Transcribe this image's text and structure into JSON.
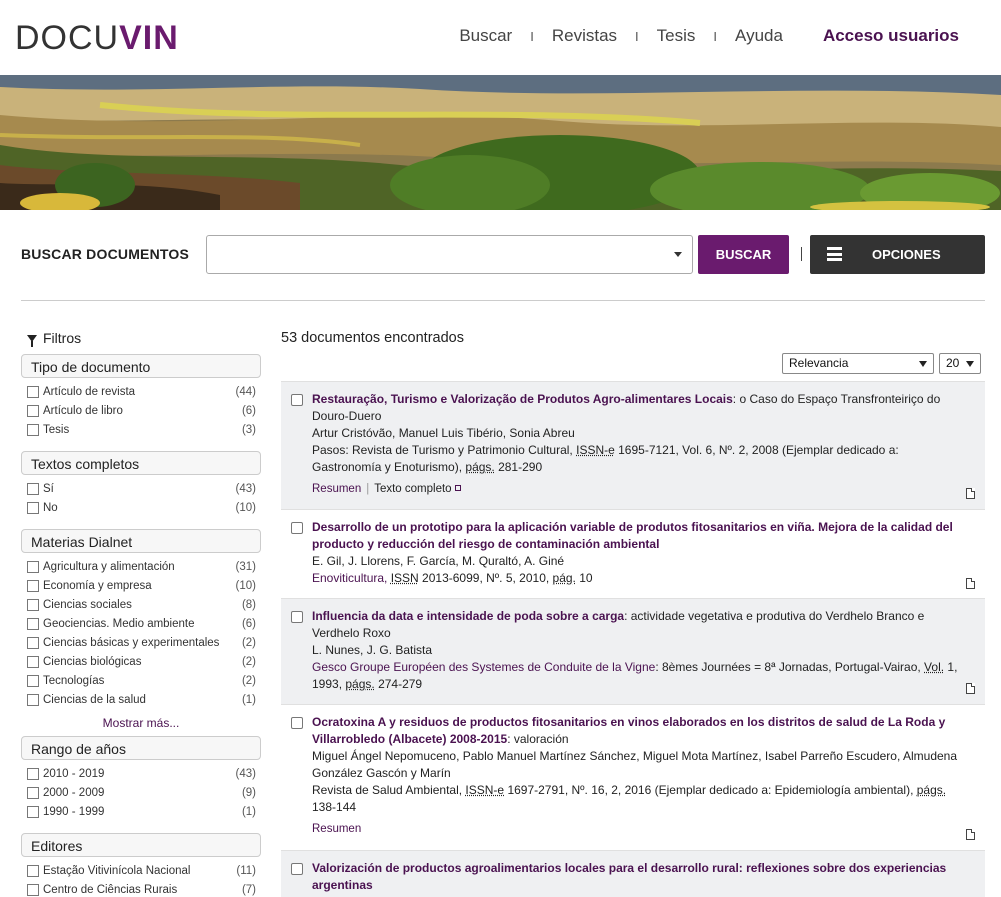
{
  "header": {
    "logo_a": "DOCU",
    "logo_b": "VIN",
    "nav": [
      "Buscar",
      "Revistas",
      "Tesis",
      "Ayuda"
    ],
    "nav_strong": "Acceso usuarios",
    "separator": "I"
  },
  "search": {
    "label": "BUSCAR DOCUMENTOS",
    "value": "",
    "button": "BUSCAR",
    "options_button": "OPCIONES"
  },
  "sidebar": {
    "title": "Filtros",
    "groups": [
      {
        "title": "Tipo de documento",
        "items": [
          {
            "name": "Artículo de revista",
            "count": "(44)"
          },
          {
            "name": "Artículo de libro",
            "count": "(6)"
          },
          {
            "name": "Tesis",
            "count": "(3)"
          }
        ]
      },
      {
        "title": "Textos completos",
        "items": [
          {
            "name": "Sí",
            "count": "(43)"
          },
          {
            "name": "No",
            "count": "(10)"
          }
        ]
      },
      {
        "title": "Materias Dialnet",
        "items": [
          {
            "name": "Agricultura y alimentación",
            "count": "(31)"
          },
          {
            "name": "Economía y empresa",
            "count": "(10)"
          },
          {
            "name": "Ciencias sociales",
            "count": "(8)"
          },
          {
            "name": "Geociencias. Medio ambiente",
            "count": "(6)"
          },
          {
            "name": "Ciencias básicas y experimentales",
            "count": "(2)"
          },
          {
            "name": "Ciencias biológicas",
            "count": "(2)"
          },
          {
            "name": "Tecnologías",
            "count": "(2)"
          },
          {
            "name": "Ciencias de la salud",
            "count": "(1)"
          }
        ]
      },
      {
        "title": "Rango de años",
        "items": [
          {
            "name": "2010 - 2019",
            "count": "(43)"
          },
          {
            "name": "2000 - 2009",
            "count": "(9)"
          },
          {
            "name": "1990 - 1999",
            "count": "(1)"
          }
        ]
      },
      {
        "title": "Editores",
        "items": [
          {
            "name": "Estação Vitivinícola Nacional",
            "count": "(11)"
          },
          {
            "name": "Centro de Ciências Rurais",
            "count": "(7)"
          }
        ]
      }
    ],
    "more": "Mostrar más..."
  },
  "results": {
    "found": "53 documentos encontrados",
    "sort": "Relevancia",
    "per_page": "20",
    "items": [
      {
        "title": "Restauração, Turismo e Valorização de Produtos Agro-alimentares Locais",
        "subtitle": ": o Caso do Espaço Transfronteiriço do Douro-Duero",
        "authors": "Artur Cristóvão, Manuel Luis Tibério, Sonia Abreu",
        "source_a": "Pasos: Revista de Turismo y Patrimonio Cultural, ",
        "source_u1": "ISSN-e",
        "source_b": " 1695-7121, Vol. 6, Nº. 2, 2008 (Ejemplar dedicado a: Gastronomía y Enoturismo), ",
        "source_u2": "págs.",
        "source_c": " 281-290",
        "link1": "Resumen",
        "link2": "Texto completo"
      },
      {
        "title": "Desarrollo de un prototipo para la aplicación variable de produtos fitosanitarios en viña. Mejora de la calidad del producto y reducción del riesgo de contaminación ambiental",
        "subtitle": "",
        "authors": "E. Gil, J. Llorens, F. García, M. Quraltó, A. Giné",
        "source_a": "Enoviticultura, ",
        "source_u1": "ISSN",
        "source_b": " 2013-6099, Nº. 5, 2010, ",
        "source_u2": "pág.",
        "source_c": " 10"
      },
      {
        "title": "Influencia da data e intensidade de poda sobre a carga",
        "subtitle": ": actividade vegetativa e produtiva do Verdhelo Branco e Verdhelo Roxo",
        "authors": "L. Nunes, J. G. Batista",
        "source_a": "Gesco Groupe Européen des Systemes de Conduite de la Vigne",
        "source_b": ": 8èmes Journées = 8ª Jornadas, Portugal-Vairao, ",
        "source_u1": "Vol.",
        "source_c": " 1, 1993, ",
        "source_u2": "págs.",
        "source_d": " 274-279"
      },
      {
        "title": "Ocratoxina A y residuos de productos fitosanitarios en vinos elaborados en los distritos de salud de La Roda y Villarrobledo (Albacete) 2008-2015",
        "subtitle": ": valoración",
        "authors": "Miguel Ángel Nepomuceno, Pablo Manuel Martínez Sánchez, Miguel Mota Martínez, Isabel Parreño Escudero, Almudena González Gascón y Marín",
        "source_a": "Revista de Salud Ambiental, ",
        "source_u1": "ISSN-e",
        "source_b": " 1697-2791, Nº. 16, 2, 2016 (Ejemplar dedicado a: Epidemiología ambiental), ",
        "source_u2": "págs.",
        "source_c": " 138-144",
        "link1": "Resumen"
      },
      {
        "title": "Valorización de productos agroalimentarios locales para el desarrollo rural: reflexiones sobre dos experiencias argentinas",
        "subtitle": ""
      }
    ]
  }
}
